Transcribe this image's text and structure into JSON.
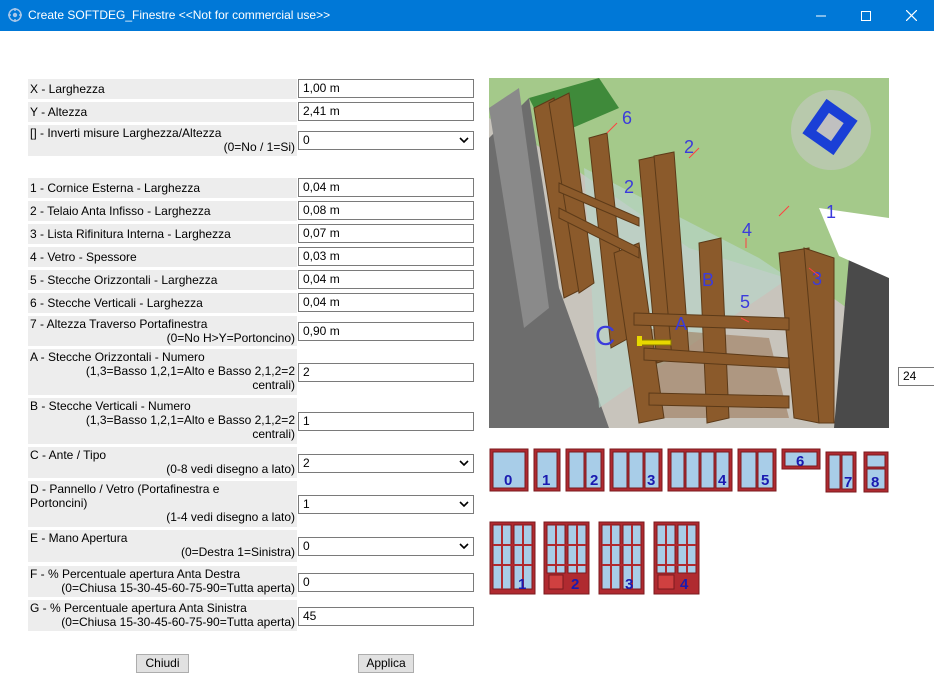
{
  "window": {
    "title": "Create SOFTDEG_Finestre <<Not for commercial use>>"
  },
  "fields": [
    {
      "label": "X - Larghezza",
      "value": "1,00 m"
    },
    {
      "label": "Y - Altezza",
      "value": "2,41 m"
    },
    {
      "label": "[] - Inverti misure Larghezza/Altezza",
      "hint": "(0=No / 1=Si)",
      "value": "0"
    },
    {
      "label": "1 - Cornice Esterna - Larghezza",
      "value": "0,04 m"
    },
    {
      "label": "2 - Telaio Anta Infisso - Larghezza",
      "value": "0,08 m"
    },
    {
      "label": "3 - Lista Rifinitura Interna - Larghezza",
      "value": "0,07 m"
    },
    {
      "label": "4 - Vetro - Spessore",
      "value": "0,03 m"
    },
    {
      "label": "5 - Stecche Orizzontali - Larghezza",
      "value": "0,04 m"
    },
    {
      "label": "6 - Stecche Verticali - Larghezza",
      "value": "0,04 m"
    },
    {
      "label": "7 - Altezza Traverso Portafinestra",
      "hint": "(0=No H>Y=Portoncino)",
      "value": "0,90 m"
    },
    {
      "label": "A - Stecche Orizzontali - Numero",
      "hint": "(1,3=Basso 1,2,1=Alto e Basso 2,1,2=2",
      "hint2": "centrali)",
      "value": "2"
    },
    {
      "label": "B - Stecche Verticali - Numero",
      "hint": "(1,3=Basso 1,2,1=Alto e Basso 2,1,2=2",
      "hint2": "centrali)",
      "value": "1"
    },
    {
      "label": "C - Ante / Tipo",
      "hint": "(0-8 vedi disegno a lato)",
      "value": "2"
    },
    {
      "label": "D - Pannello / Vetro (Portafinestra e",
      "label2": "Portoncini)",
      "hint": "(1-4 vedi disegno a lato)",
      "value": "1"
    },
    {
      "label": "E - Mano Apertura",
      "hint": "(0=Destra 1=Sinistra)",
      "value": "0"
    },
    {
      "label": "F - % Percentuale apertura Anta Destra",
      "hint": "(0=Chiusa 15-30-45-60-75-90=Tutta aperta)",
      "value": "0"
    },
    {
      "label": "G - % Percentuale apertura Anta Sinistra",
      "hint": "(0=Chiusa 15-30-45-60-75-90=Tutta aperta)",
      "value": "45"
    }
  ],
  "buttons": {
    "close": "Chiudi",
    "apply": "Applica"
  },
  "side_value": "24",
  "preview": {
    "labels": {
      "c": "C",
      "a": "A",
      "b": "B",
      "n1": "1",
      "n2a": "2",
      "n2b": "2",
      "n3": "3",
      "n4": "4",
      "n5": "5",
      "n6": "6"
    }
  },
  "types": [
    "0",
    "1",
    "2",
    "3",
    "4",
    "5",
    "6",
    "7",
    "8"
  ],
  "panels": [
    "1",
    "2",
    "3",
    "4"
  ],
  "colors": {
    "titlebar": "#0078d7",
    "frame": "#b02a30",
    "glass": "#a8cde8",
    "label_blue": "#2020cc"
  }
}
